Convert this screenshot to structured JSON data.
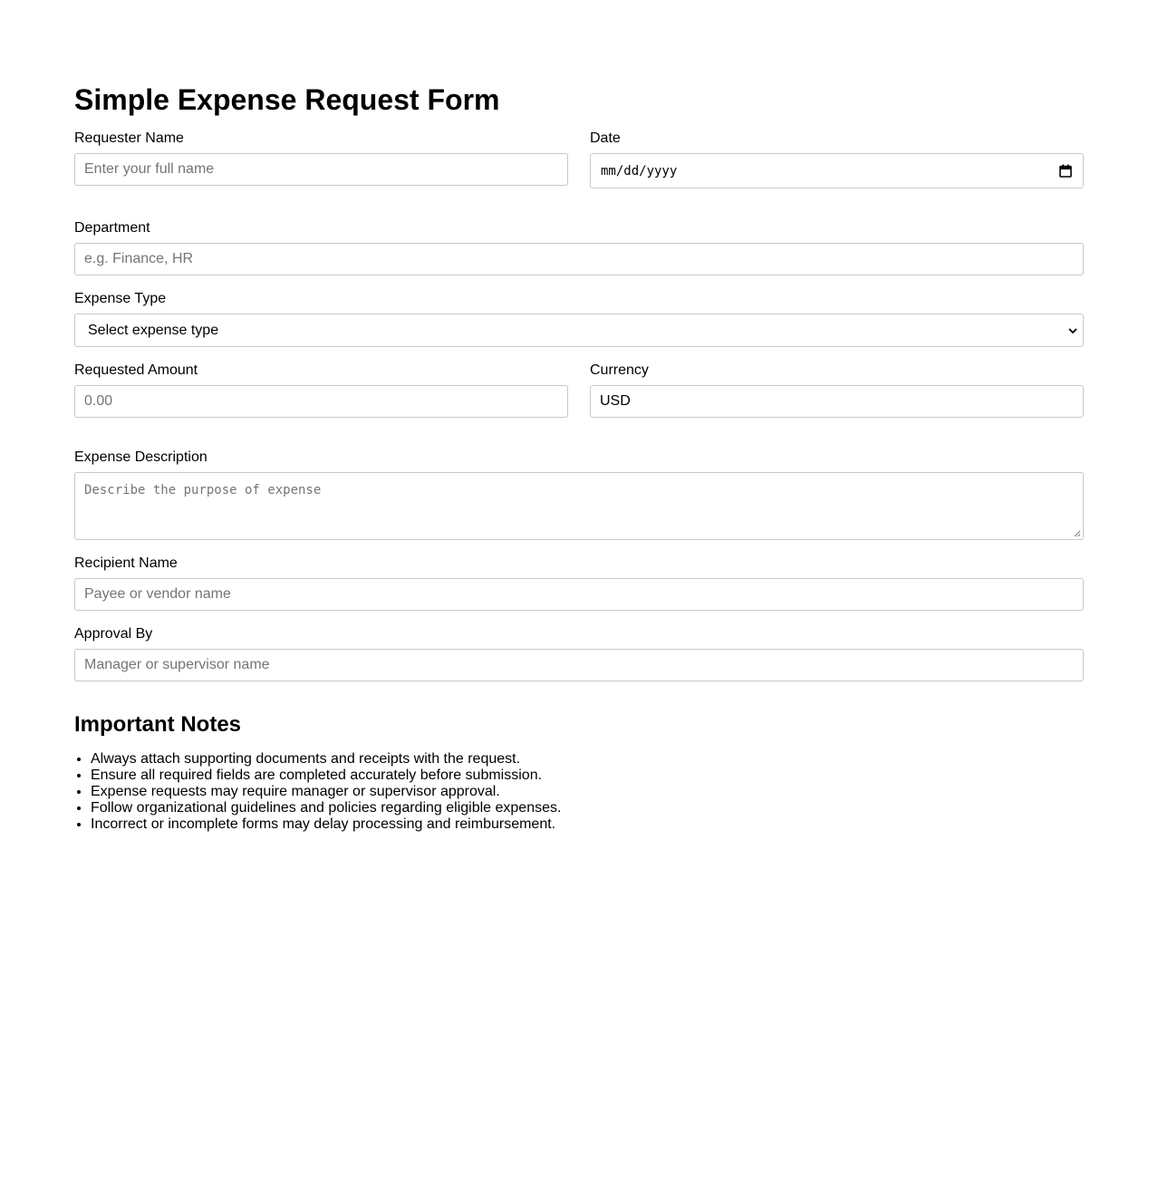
{
  "form": {
    "title": "Simple Expense Request Form",
    "requester_name": {
      "label": "Requester Name",
      "placeholder": "Enter your full name",
      "value": ""
    },
    "date": {
      "label": "Date",
      "placeholder": "mm/dd/yyyy",
      "value": ""
    },
    "department": {
      "label": "Department",
      "placeholder": "e.g. Finance, HR",
      "value": ""
    },
    "expense_type": {
      "label": "Expense Type",
      "selected": "Select expense type"
    },
    "requested_amount": {
      "label": "Requested Amount",
      "placeholder": "0.00",
      "value": ""
    },
    "currency": {
      "label": "Currency",
      "value": "USD"
    },
    "expense_description": {
      "label": "Expense Description",
      "placeholder": "Describe the purpose of expense",
      "value": ""
    },
    "recipient_name": {
      "label": "Recipient Name",
      "placeholder": "Payee or vendor name",
      "value": ""
    },
    "approval_by": {
      "label": "Approval By",
      "placeholder": "Manager or supervisor name",
      "value": ""
    }
  },
  "notes": {
    "title": "Important Notes",
    "items": [
      "Always attach supporting documents and receipts with the request.",
      "Ensure all required fields are completed accurately before submission.",
      "Expense requests may require manager or supervisor approval.",
      "Follow organizational guidelines and policies regarding eligible expenses.",
      "Incorrect or incomplete forms may delay processing and reimbursement."
    ]
  },
  "icons": {
    "date_picker": "calendar-icon",
    "select_arrow": "chevron-down-icon",
    "textarea_grip": "resize-handle-icon"
  },
  "colors": {
    "text": "#000000",
    "placeholder": "#757575",
    "field_border": "#c8c8c8",
    "background": "#ffffff"
  }
}
